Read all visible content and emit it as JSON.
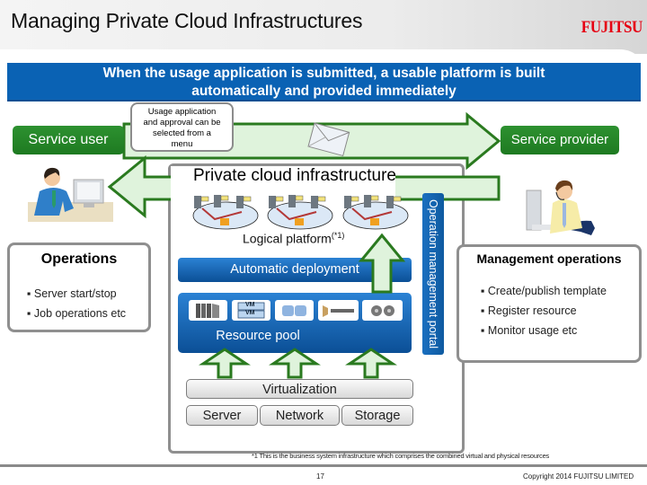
{
  "header": {
    "title": "Managing Private Cloud Infrastructures",
    "logo_text": "FUJITSU",
    "brand_color": "#e60012"
  },
  "banner": {
    "line1": "When the usage application is submitted, a usable platform is built",
    "line2": "automatically and provided immediately",
    "color": "#0a62b4"
  },
  "flow": {
    "service_user": "Service user",
    "service_provider": "Service provider",
    "usage_note_lines": [
      "Usage application",
      "and approval can be",
      "selected from a",
      "menu"
    ],
    "mail_icon": "envelope-icon"
  },
  "cloud": {
    "title": "Private cloud infrastructure",
    "logical_platform": "Logical platform",
    "logical_platform_note": "(*1)",
    "automatic_deployment": "Automatic deployment",
    "resource_pool": "Resource pool",
    "resource_icons": [
      "server-rack-icon",
      "vm-icon",
      "storage-disk-icon",
      "network-switch-icon",
      "tape-icon"
    ],
    "vm_label": "VM",
    "portal": "Operation management portal"
  },
  "operations": {
    "title": "Operations",
    "items": [
      "Server start/stop",
      "Job operations etc"
    ]
  },
  "management": {
    "title": "Management operations",
    "items": [
      "Create/publish template",
      "Register resource",
      "Monitor usage etc"
    ]
  },
  "layers": {
    "virtualization": "Virtualization",
    "server": "Server",
    "network": "Network",
    "storage": "Storage"
  },
  "footer": {
    "footnote": "*1 This is the business system infrastructure which comprises the combined virtual and physical resources",
    "page_number": "17",
    "copyright": "Copyright 2014 FUJITSU LIMITED"
  }
}
